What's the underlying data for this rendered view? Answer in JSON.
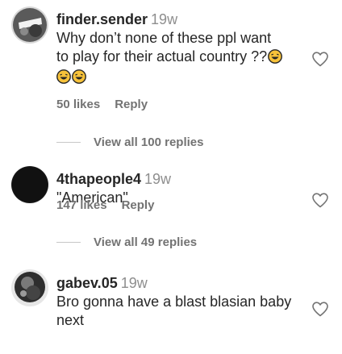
{
  "comments": [
    {
      "username": "finder.sender",
      "time": "19w",
      "text_line1": "Why don’t none of these ppl want",
      "text_line2": "to play for their actual country ??",
      "likes": "50 likes",
      "reply": "Reply",
      "view_replies": "View all 100 replies"
    },
    {
      "username": "4thapeople4",
      "time": "19w",
      "text": "\"American\"",
      "likes": "147 likes",
      "reply": "Reply",
      "view_replies": "View all 49 replies"
    },
    {
      "username": "gabev.05",
      "time": "19w",
      "text_line1": "Bro gonna have a blast blasian baby",
      "text_line2": "next"
    }
  ],
  "colors": {
    "text": "#262626",
    "secondary": "#737373",
    "timestamp": "#8e8e8e",
    "divider": "#c7c7c7",
    "emoji": "#f7c23a"
  },
  "icons": [
    "heart-icon",
    "laughing-emoji-icon"
  ]
}
